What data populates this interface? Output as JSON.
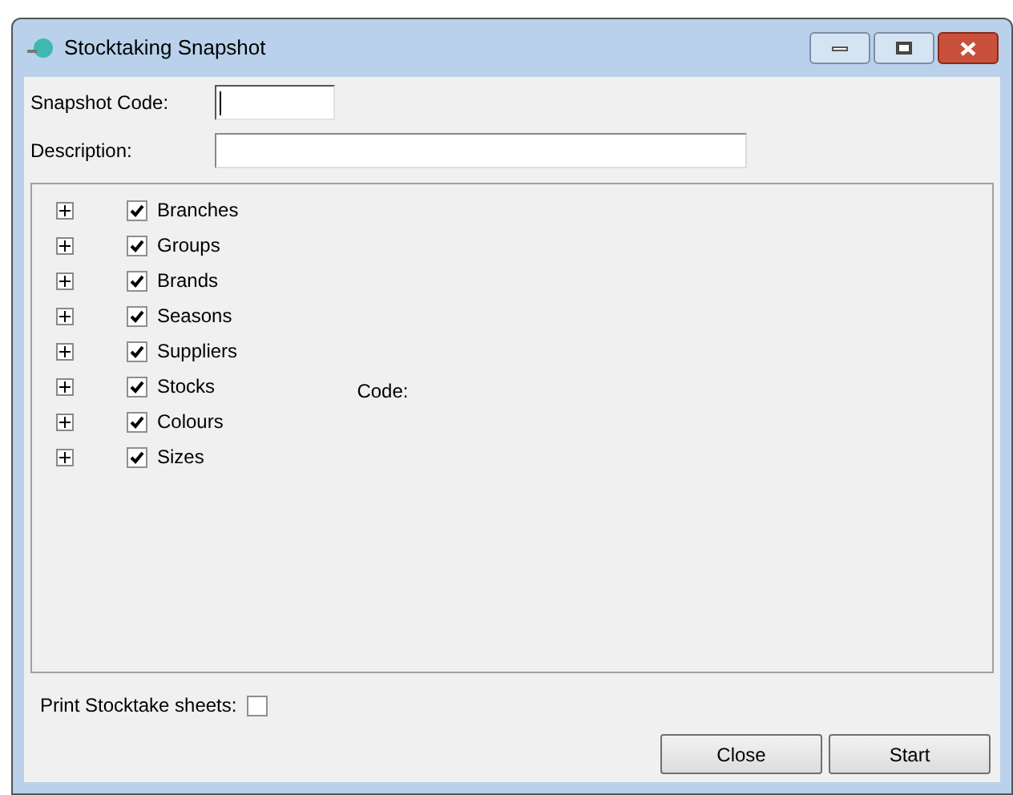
{
  "window": {
    "title": "Stocktaking Snapshot"
  },
  "fields": [
    {
      "label": "Snapshot Code:",
      "focused": true
    },
    {
      "label": "Description:",
      "focused": false
    }
  ],
  "tree": [
    {
      "label": "Branches",
      "checked": true,
      "expanded": false
    },
    {
      "label": "Groups",
      "checked": true,
      "expanded": false
    },
    {
      "label": "Brands",
      "checked": true,
      "expanded": false
    },
    {
      "label": "Seasons",
      "checked": true,
      "expanded": false
    },
    {
      "label": "Suppliers",
      "checked": true,
      "expanded": false
    },
    {
      "label": "Stocks",
      "checked": true,
      "expanded": false
    },
    {
      "label": "Colours",
      "checked": true,
      "expanded": false
    },
    {
      "label": "Sizes",
      "checked": true,
      "expanded": false
    }
  ],
  "detail_label": "Code:",
  "print_sheets": {
    "label": "Print Stocktake sheets:",
    "checked": false
  },
  "buttons": [
    "Close",
    "Start"
  ]
}
